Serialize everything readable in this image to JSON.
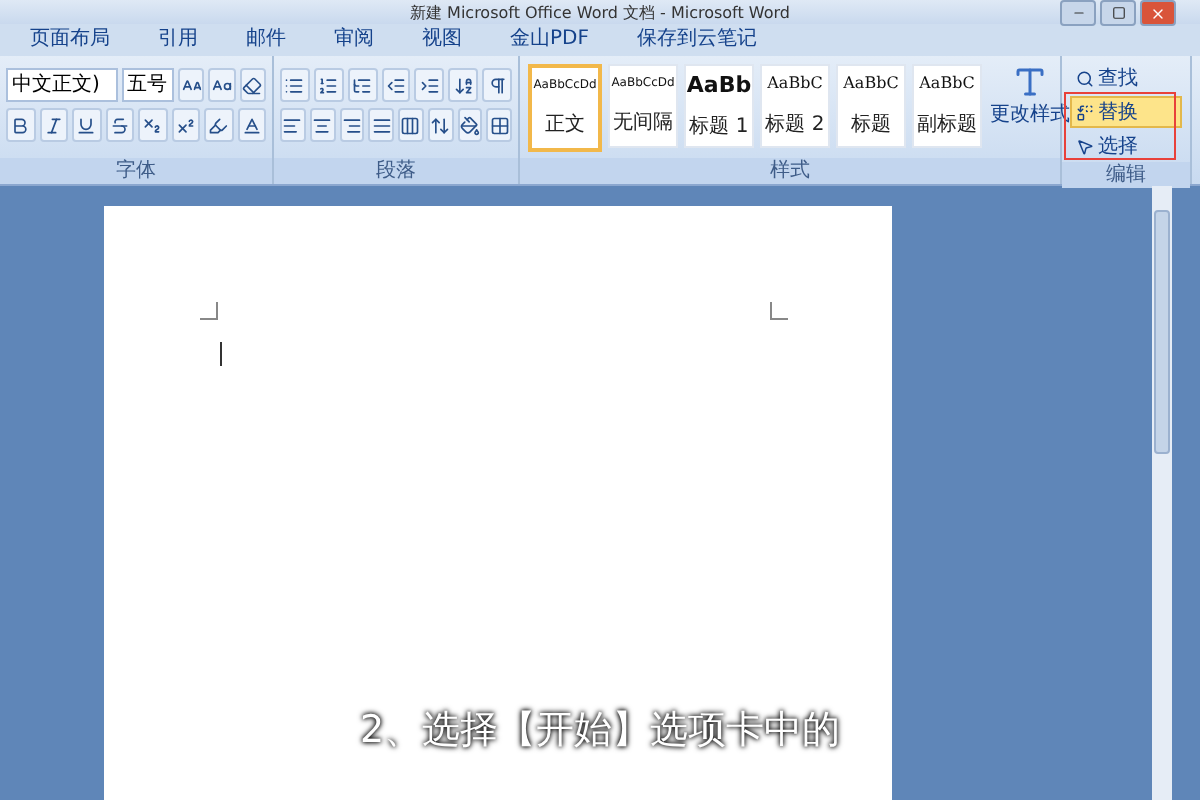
{
  "window": {
    "title": "新建 Microsoft Office Word 文档 - Microsoft Word"
  },
  "tabs": [
    {
      "label": "页面布局",
      "selected": false
    },
    {
      "label": "引用",
      "selected": false
    },
    {
      "label": "邮件",
      "selected": false
    },
    {
      "label": "审阅",
      "selected": false
    },
    {
      "label": "视图",
      "selected": false
    },
    {
      "label": "金山PDF",
      "selected": false
    },
    {
      "label": "保存到云笔记",
      "selected": false
    }
  ],
  "font_group": {
    "font_name": "中文正文)",
    "font_size": "五号",
    "label": "字体"
  },
  "paragraph_group": {
    "label": "段落"
  },
  "styles_group": {
    "label": "样式",
    "change_styles": "更改样式",
    "styles": [
      {
        "preview": "AaBbCcDd",
        "name": "正文",
        "selected": true,
        "kind": "small"
      },
      {
        "preview": "AaBbCcDd",
        "name": "无间隔",
        "selected": false,
        "kind": "small"
      },
      {
        "preview": "AaBb",
        "name": "标题 1",
        "selected": false,
        "kind": "heading"
      },
      {
        "preview": "AaBbC",
        "name": "标题 2",
        "selected": false,
        "kind": "serif"
      },
      {
        "preview": "AaBbC",
        "name": "标题",
        "selected": false,
        "kind": "serif"
      },
      {
        "preview": "AaBbC",
        "name": "副标题",
        "selected": false,
        "kind": "serif"
      }
    ]
  },
  "editing_group": {
    "label": "编辑",
    "items": [
      {
        "label": "查找",
        "kind": "find",
        "hovered": false
      },
      {
        "label": "替换",
        "kind": "replace",
        "hovered": true
      },
      {
        "label": "选择",
        "kind": "select",
        "hovered": false
      }
    ]
  },
  "subtitle": "2、选择【开始】选项卡中的"
}
